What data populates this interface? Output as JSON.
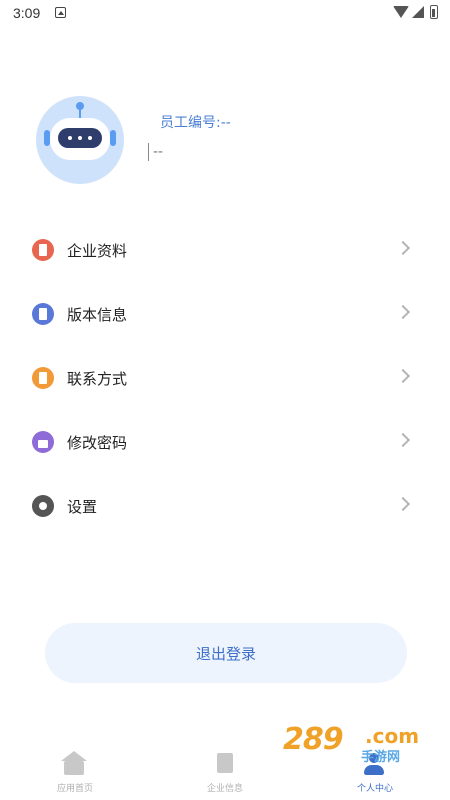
{
  "status_bar": {
    "time": "3:09"
  },
  "profile": {
    "employee_no": "员工编号:--",
    "name": "--"
  },
  "menu": {
    "items": [
      {
        "label": "企业资料",
        "icon": "company-doc-icon",
        "color": "#e8664f"
      },
      {
        "label": "版本信息",
        "icon": "version-icon",
        "color": "#5a78d8"
      },
      {
        "label": "联系方式",
        "icon": "contact-icon",
        "color": "#f29a38"
      },
      {
        "label": "修改密码",
        "icon": "lock-icon",
        "color": "#8e6bd6"
      },
      {
        "label": "设置",
        "icon": "settings-icon",
        "color": "#555555"
      }
    ]
  },
  "logout_label": "退出登录",
  "bottom_nav": {
    "items": [
      {
        "label": "应用首页",
        "icon": "home-icon",
        "active": false
      },
      {
        "label": "企业信息",
        "icon": "building-icon",
        "active": false
      },
      {
        "label": "个人中心",
        "icon": "person-icon",
        "active": true
      }
    ]
  },
  "watermark": {
    "number": "289",
    "suffix": ".com",
    "cn": "手游网"
  },
  "colors": {
    "accent": "#3d6fc8",
    "logout_bg": "#eef4fd"
  }
}
